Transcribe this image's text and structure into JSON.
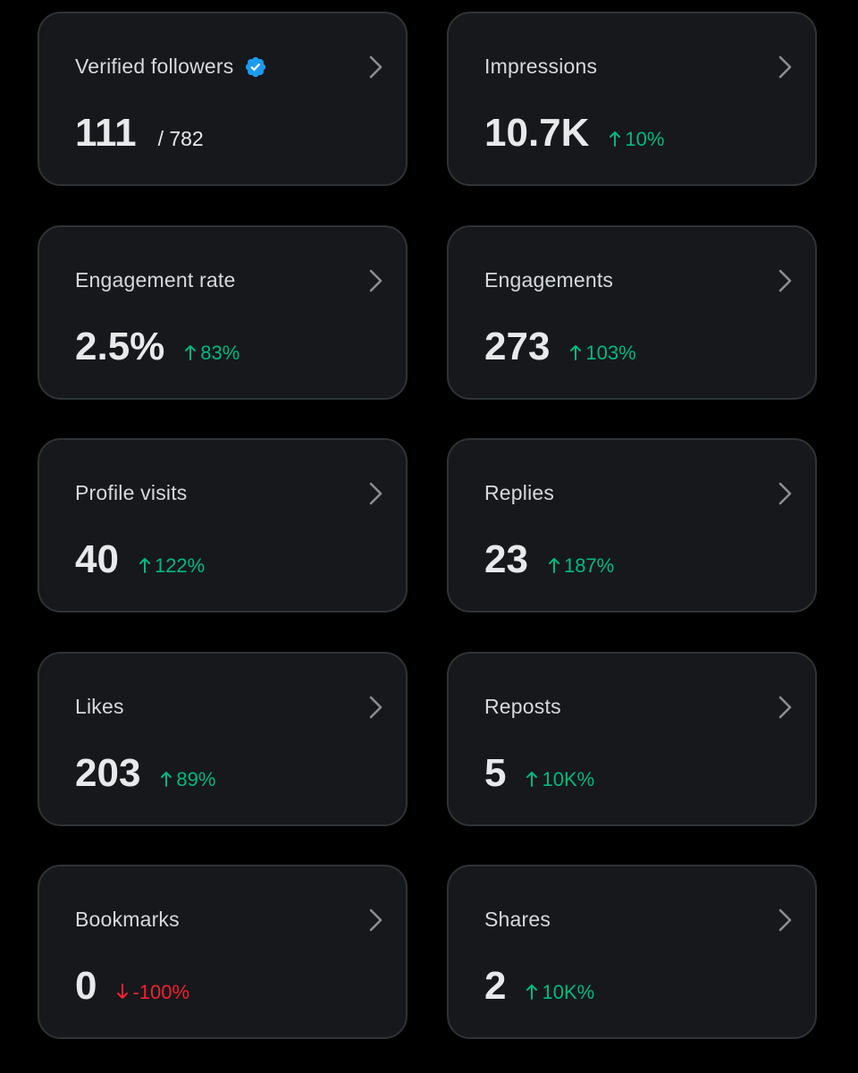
{
  "colors": {
    "background": "#000000",
    "card_background": "#16181c",
    "card_border": "#2f3336",
    "positive": "#00ba7c",
    "negative": "#f4212e",
    "verified": "#1d9bf0"
  },
  "cards": [
    {
      "label": "Verified followers",
      "value": "111",
      "denominator": "/ 782",
      "icons": [
        "verified-badge-icon",
        "chevron-right-icon"
      ]
    },
    {
      "label": "Impressions",
      "value": "10.7K",
      "change": "10%",
      "direction": "up",
      "icons": [
        "arrow-up-icon",
        "chevron-right-icon"
      ]
    },
    {
      "label": "Engagement rate",
      "value": "2.5%",
      "change": "83%",
      "direction": "up",
      "icons": [
        "arrow-up-icon",
        "chevron-right-icon"
      ]
    },
    {
      "label": "Engagements",
      "value": "273",
      "change": "103%",
      "direction": "up",
      "icons": [
        "arrow-up-icon",
        "chevron-right-icon"
      ]
    },
    {
      "label": "Profile visits",
      "value": "40",
      "change": "122%",
      "direction": "up",
      "icons": [
        "arrow-up-icon",
        "chevron-right-icon"
      ]
    },
    {
      "label": "Replies",
      "value": "23",
      "change": "187%",
      "direction": "up",
      "icons": [
        "arrow-up-icon",
        "chevron-right-icon"
      ]
    },
    {
      "label": "Likes",
      "value": "203",
      "change": "89%",
      "direction": "up",
      "icons": [
        "arrow-up-icon",
        "chevron-right-icon"
      ]
    },
    {
      "label": "Reposts",
      "value": "5",
      "change": "10K%",
      "direction": "up",
      "icons": [
        "arrow-up-icon",
        "chevron-right-icon"
      ]
    },
    {
      "label": "Bookmarks",
      "value": "0",
      "change": "-100%",
      "direction": "down",
      "icons": [
        "arrow-down-icon",
        "chevron-right-icon"
      ]
    },
    {
      "label": "Shares",
      "value": "2",
      "change": "10K%",
      "direction": "up",
      "icons": [
        "arrow-up-icon",
        "chevron-right-icon"
      ]
    }
  ]
}
